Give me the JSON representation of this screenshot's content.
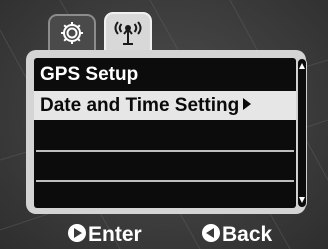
{
  "tabs": [
    {
      "icon": "gear-icon",
      "active": false
    },
    {
      "icon": "gps-antenna-icon",
      "active": true
    }
  ],
  "menu": {
    "items": [
      {
        "label": "GPS Setup",
        "selected": false
      },
      {
        "label": "Date and Time Setting",
        "selected": true,
        "has_submenu": true
      },
      {
        "label": "",
        "selected": false
      },
      {
        "label": "",
        "selected": false
      },
      {
        "label": "",
        "selected": false
      }
    ]
  },
  "footer": {
    "enter_label": "Enter",
    "back_label": "Back"
  },
  "colors": {
    "background": "#3a3a3a",
    "panel": "#d4d4d4",
    "menu_bg": "#0c0c0c",
    "highlight": "#e6e6e6",
    "text": "#ffffff"
  }
}
